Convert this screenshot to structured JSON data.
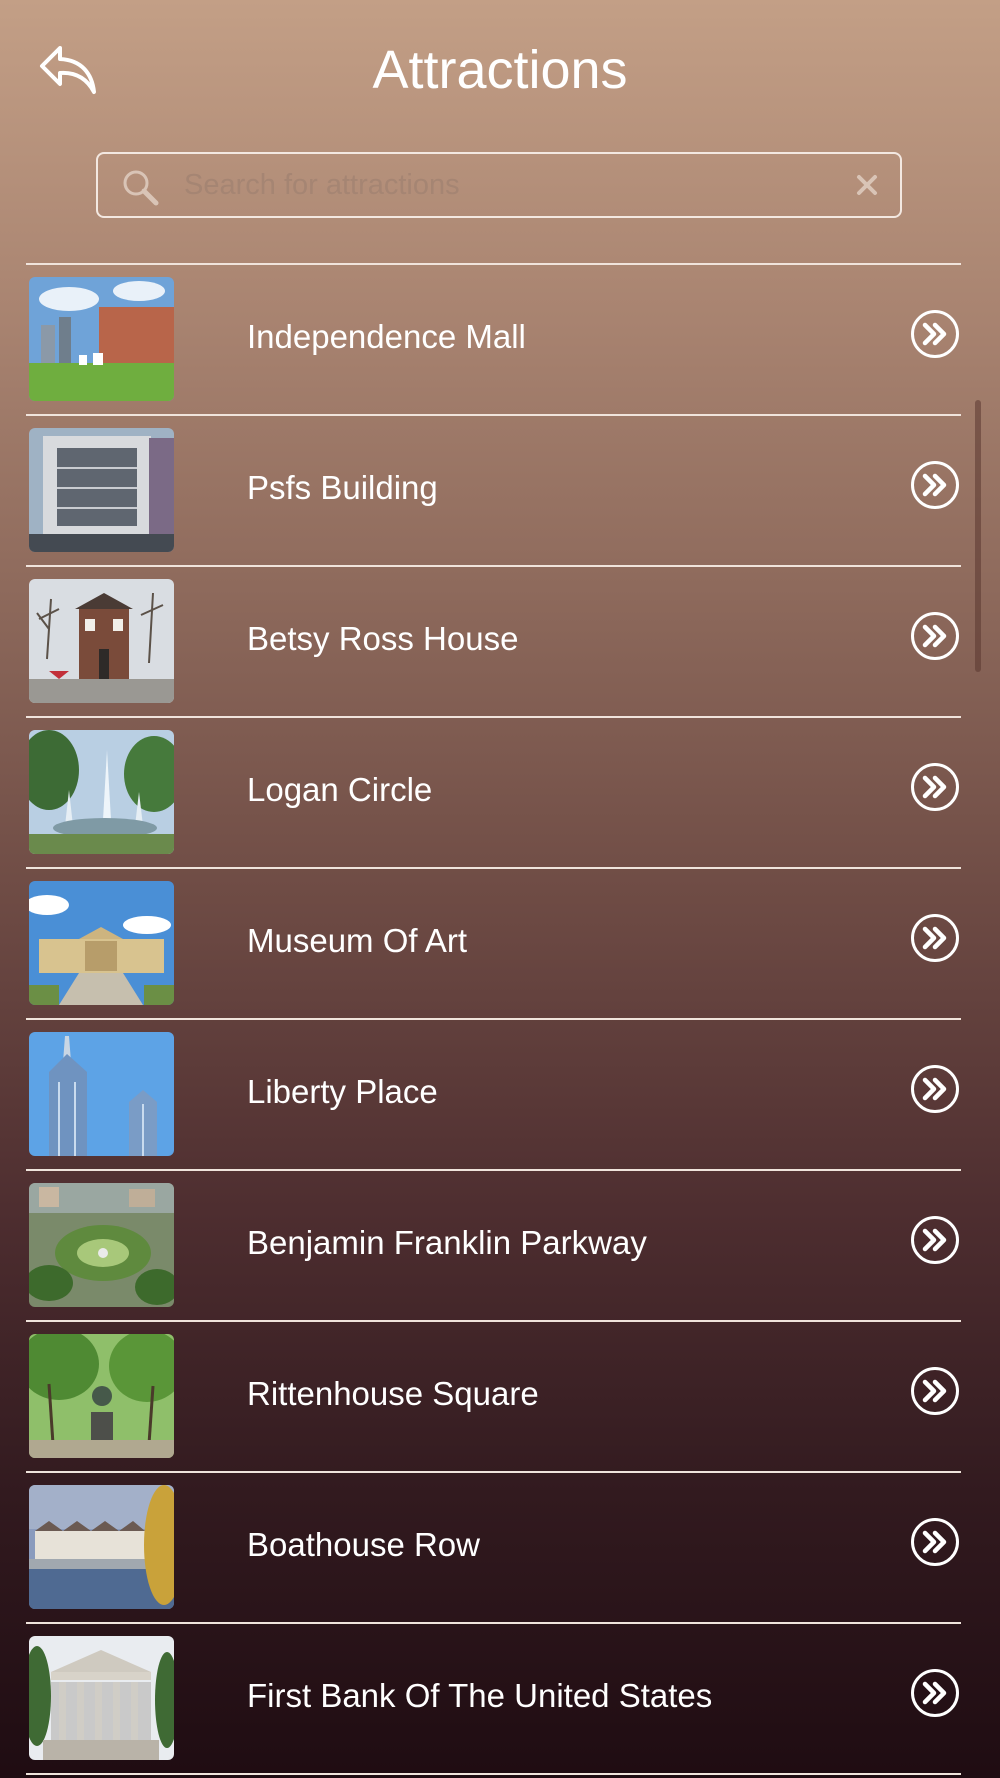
{
  "header": {
    "title": "Attractions",
    "back_icon": "back-reply-icon"
  },
  "search": {
    "placeholder": "Search for attractions",
    "value": "",
    "search_icon": "search-icon",
    "clear_icon": "close-icon"
  },
  "attractions": [
    {
      "label": "Independence Mall",
      "thumbnail": "plaza with brick building and blue sky",
      "action_icon": "double-chevron-right-icon"
    },
    {
      "label": "Psfs Building",
      "thumbnail": "modernist office tower at street corner",
      "action_icon": "double-chevron-right-icon"
    },
    {
      "label": "Betsy Ross House",
      "thumbnail": "colonial brick house with flags",
      "action_icon": "double-chevron-right-icon"
    },
    {
      "label": "Logan Circle",
      "thumbnail": "fountain surrounded by trees",
      "action_icon": "double-chevron-right-icon"
    },
    {
      "label": "Museum Of Art",
      "thumbnail": "museum building with steps",
      "action_icon": "double-chevron-right-icon"
    },
    {
      "label": "Liberty Place",
      "thumbnail": "blue glass skyscrapers",
      "action_icon": "double-chevron-right-icon"
    },
    {
      "label": "Benjamin Franklin Parkway",
      "thumbnail": "aerial view of circular park",
      "action_icon": "double-chevron-right-icon"
    },
    {
      "label": "Rittenhouse Square",
      "thumbnail": "park with statue and trees",
      "action_icon": "double-chevron-right-icon"
    },
    {
      "label": "Boathouse Row",
      "thumbnail": "boathouses along river",
      "action_icon": "double-chevron-right-icon"
    },
    {
      "label": "First Bank Of The United States",
      "thumbnail": "classical columned bank building",
      "action_icon": "double-chevron-right-icon"
    }
  ],
  "colors": {
    "background_top": "#c39f86",
    "background_bottom": "#1f0c12",
    "text": "#ffffff",
    "divider": "#f0e4dc",
    "placeholder": "#a58573"
  }
}
